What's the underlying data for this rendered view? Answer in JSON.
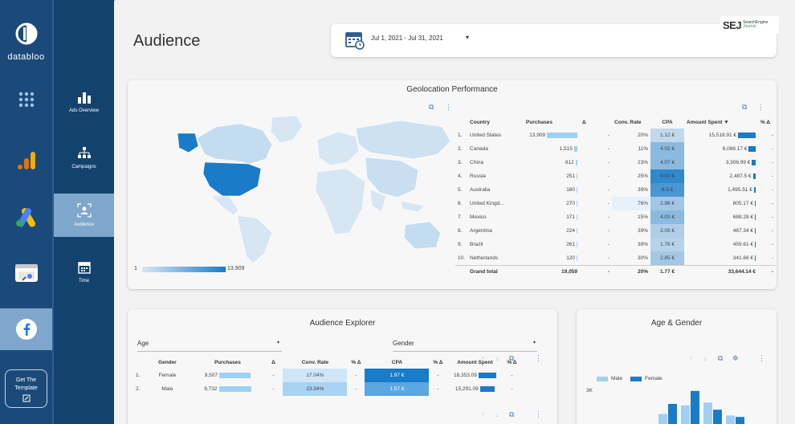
{
  "brand": {
    "name": "databloo"
  },
  "rail": {
    "cta_line1": "Get The",
    "cta_line2": "Template"
  },
  "subnav": {
    "items": [
      {
        "label": "Ads Overview"
      },
      {
        "label": "Campaigns"
      },
      {
        "label": "Audience"
      },
      {
        "label": "Time"
      }
    ]
  },
  "header": {
    "title": "Audience",
    "date_range": "Jul 1, 2021 - Jul 31, 2021",
    "watermark_big": "SEJ",
    "watermark_small_1": "SearchEngine",
    "watermark_small_2": "Journal"
  },
  "geo": {
    "title": "Geolocation Performance",
    "legend_min": "1",
    "legend_max": "13,909",
    "headers": [
      "Country",
      "Purchases",
      "Δ",
      "Conv. Rate",
      "CPA",
      "Amount Spent ▼",
      "% Δ"
    ],
    "rows": [
      {
        "idx": "1.",
        "country": "United States",
        "purchases": "13,909",
        "pbar": 1.0,
        "delta": "-",
        "conv": "20%",
        "cpa": "1.12 €",
        "cpa_lvl": 0.12,
        "spent": "15,518.91 €",
        "sbar": 1.0,
        "pdelta": "-"
      },
      {
        "idx": "2.",
        "country": "Canada",
        "purchases": "1,515",
        "pbar": 0.11,
        "delta": "-",
        "conv": "11%",
        "cpa": "4.02 €",
        "cpa_lvl": 0.45,
        "spent": "6,088.17 €",
        "sbar": 0.39,
        "pdelta": "-"
      },
      {
        "idx": "3.",
        "country": "China",
        "purchases": "812",
        "pbar": 0.06,
        "delta": "-",
        "conv": "23%",
        "cpa": "4.07 €",
        "cpa_lvl": 0.46,
        "spent": "3,306.99 €",
        "sbar": 0.21,
        "pdelta": "-"
      },
      {
        "idx": "4.",
        "country": "Russia",
        "purchases": "251",
        "pbar": 0.02,
        "delta": "-",
        "conv": "25%",
        "cpa": "9.91 €",
        "cpa_lvl": 1.0,
        "spent": "2,487.5 €",
        "sbar": 0.16,
        "pdelta": "-"
      },
      {
        "idx": "5.",
        "country": "Australia",
        "purchases": "180",
        "pbar": 0.01,
        "delta": "-",
        "conv": "39%",
        "cpa": "8.3 €",
        "cpa_lvl": 0.85,
        "spent": "1,495.51 €",
        "sbar": 0.1,
        "pdelta": "-"
      },
      {
        "idx": "6.",
        "country": "United Kingd...",
        "purchases": "270",
        "pbar": 0.02,
        "delta": "-",
        "conv": "76%",
        "cpa": "2.98 €",
        "cpa_lvl": 0.32,
        "spent": "805.17 €",
        "sbar": 0.05,
        "pdelta": "-"
      },
      {
        "idx": "7.",
        "country": "Mexico",
        "purchases": "171",
        "pbar": 0.01,
        "delta": "-",
        "conv": "15%",
        "cpa": "4.03 €",
        "cpa_lvl": 0.45,
        "spent": "688.28 €",
        "sbar": 0.04,
        "pdelta": "-"
      },
      {
        "idx": "8.",
        "country": "Argentina",
        "purchases": "224",
        "pbar": 0.02,
        "delta": "-",
        "conv": "39%",
        "cpa": "2.09 €",
        "cpa_lvl": 0.22,
        "spent": "467.34 €",
        "sbar": 0.03,
        "pdelta": "-"
      },
      {
        "idx": "9.",
        "country": "Brazil",
        "purchases": "261",
        "pbar": 0.02,
        "delta": "-",
        "conv": "39%",
        "cpa": "1.76 €",
        "cpa_lvl": 0.18,
        "spent": "459.61 €",
        "sbar": 0.03,
        "pdelta": "-"
      },
      {
        "idx": "10.",
        "country": "Netherlands",
        "purchases": "120",
        "pbar": 0.01,
        "delta": "-",
        "conv": "30%",
        "cpa": "2.85 €",
        "cpa_lvl": 0.3,
        "spent": "341.68 €",
        "sbar": 0.02,
        "pdelta": "-"
      }
    ],
    "total": {
      "label": "Grand total",
      "purchases": "19,059",
      "delta": "-",
      "conv": "20%",
      "cpa": "1.77 €",
      "spent": "33,644.14 €",
      "pdelta": "-"
    }
  },
  "audience": {
    "title": "Audience Explorer",
    "dim1": "Age",
    "dim2": "Gender",
    "headers": [
      "Gender",
      "Purchases",
      "Δ",
      "Conv. Rate",
      "% Δ",
      "CPA",
      "% Δ",
      "Amount Spent",
      "% Δ"
    ],
    "rows": [
      {
        "idx": "1.",
        "gender": "Female",
        "purchases": "9,507",
        "pbar": 0.98,
        "delta": "-",
        "conv": "17.04%",
        "pd1": "-",
        "cpa": "1.97 €",
        "pd2": "-",
        "spent": "18,353.09",
        "sbar": 1.0,
        "pd3": "-"
      },
      {
        "idx": "2.",
        "gender": "Male",
        "purchases": "9,732",
        "pbar": 1.0,
        "delta": "-",
        "conv": "23.94%",
        "pd1": "-",
        "cpa": "1.57 €",
        "pd2": "-",
        "spent": "15,291.09",
        "sbar": 0.83,
        "pd3": "-"
      }
    ]
  },
  "age_gender": {
    "title": "Age & Gender",
    "legend": [
      "Male",
      "Female"
    ],
    "y_tick": "3K"
  },
  "colors": {
    "accent": "#1a7bc8",
    "light_bar": "#9fd0f3",
    "nav_dark": "#14426e",
    "nav_active": "#7fa6cc"
  },
  "chart_data": {
    "type": "bar",
    "title": "Age & Gender",
    "series": [
      {
        "name": "Male",
        "values": [
          800,
          1400,
          1600,
          700
        ]
      },
      {
        "name": "Female",
        "values": [
          1500,
          2400,
          1100,
          600
        ]
      }
    ],
    "categories": [
      "",
      "",
      "",
      ""
    ],
    "ylim": [
      0,
      3000
    ]
  }
}
